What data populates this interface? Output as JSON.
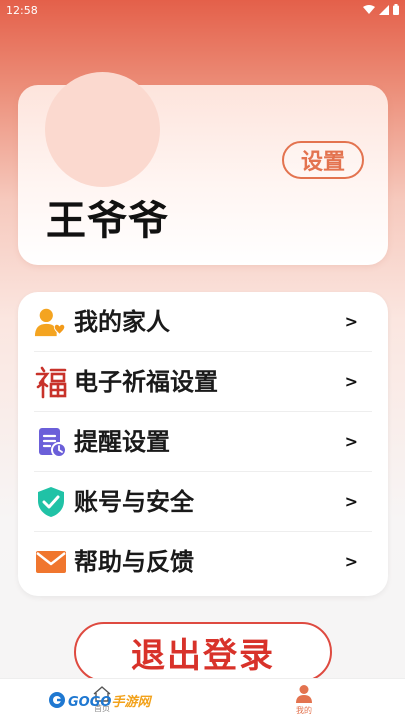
{
  "status_bar": {
    "time": "12:58"
  },
  "profile": {
    "name": "王爷爷",
    "settings_label": "设置"
  },
  "menu": {
    "items": [
      {
        "label": "我的家人",
        "icon": "family-icon",
        "arrow": ">"
      },
      {
        "label": "电子祈福设置",
        "icon": "fu-blessing-icon",
        "arrow": ">"
      },
      {
        "label": "提醒设置",
        "icon": "reminder-document-icon",
        "arrow": ">"
      },
      {
        "label": "账号与安全",
        "icon": "shield-check-icon",
        "arrow": ">"
      },
      {
        "label": "帮助与反馈",
        "icon": "mail-icon",
        "arrow": ">"
      }
    ]
  },
  "logout_label": "退出登录",
  "tab_bar": {
    "tabs": [
      {
        "label": "首页",
        "icon": "home-icon"
      },
      {
        "label": "我的",
        "icon": "person-icon"
      }
    ],
    "active": "我的"
  },
  "watermark": {
    "text_left": "GOGO",
    "text_right": "手游网"
  },
  "colors": {
    "accent": "#e3734f",
    "logout": "#d8322a"
  }
}
